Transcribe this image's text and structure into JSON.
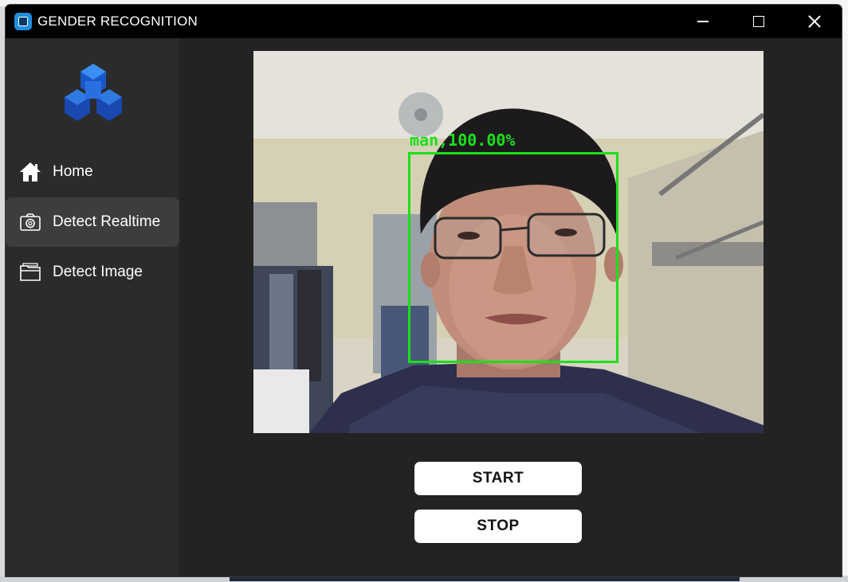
{
  "window": {
    "title": "GENDER RECOGNITION"
  },
  "sidebar": {
    "items": [
      {
        "label": "Home",
        "icon": "home-icon"
      },
      {
        "label": "Detect Realtime",
        "icon": "camera-icon",
        "active": true
      },
      {
        "label": "Detect Image",
        "icon": "folder-image-icon"
      }
    ]
  },
  "camera": {
    "detection_label": "man,100.00%",
    "detection_color": "#19e01a"
  },
  "controls": {
    "start_label": "START",
    "stop_label": "STOP"
  },
  "colors": {
    "window_bg": "#2b2b2b",
    "main_bg": "#232323",
    "titlebar_bg": "#000000",
    "active_item_bg": "#3d3d3d",
    "logo_blue": "#1a56c8"
  }
}
